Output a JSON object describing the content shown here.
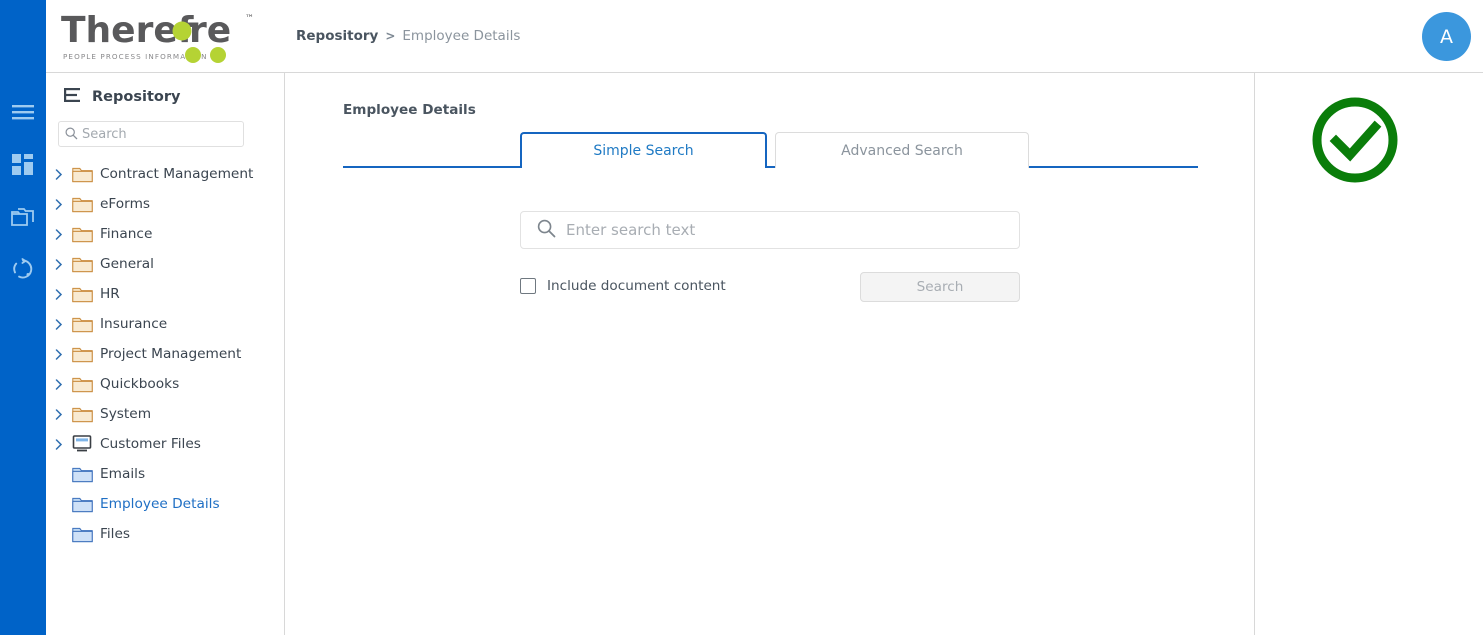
{
  "brand": {
    "name": "Therefore",
    "tagline": "PEOPLE PROCESS INFORMATION",
    "logo_text_color": "#59595b",
    "logo_accent_color": "#b5d334"
  },
  "rail": {
    "items": [
      {
        "name": "menu-icon",
        "label": "Menu"
      },
      {
        "name": "dashboard-icon",
        "label": "Dashboard"
      },
      {
        "name": "folders-icon",
        "label": "Folders"
      },
      {
        "name": "sync-icon",
        "label": "Sync"
      }
    ],
    "background": "#0063c8"
  },
  "header": {
    "breadcrumb": {
      "root": "Repository",
      "separator": ">",
      "leaf": "Employee Details"
    },
    "avatar": {
      "initial": "A",
      "color": "#3b97dd"
    }
  },
  "sidebar": {
    "title": "Repository",
    "search": {
      "value": "",
      "placeholder": "Search"
    },
    "tree": [
      {
        "label": "Contract Management",
        "icon": "folder-tan-icon",
        "expandable": true,
        "selected": false
      },
      {
        "label": "eForms",
        "icon": "folder-tan-icon",
        "expandable": true,
        "selected": false
      },
      {
        "label": "Finance",
        "icon": "folder-tan-icon",
        "expandable": true,
        "selected": false
      },
      {
        "label": "General",
        "icon": "folder-tan-icon",
        "expandable": true,
        "selected": false
      },
      {
        "label": "HR",
        "icon": "folder-tan-icon",
        "expandable": true,
        "selected": false
      },
      {
        "label": "Insurance",
        "icon": "folder-tan-icon",
        "expandable": true,
        "selected": false
      },
      {
        "label": "Project Management",
        "icon": "folder-tan-icon",
        "expandable": true,
        "selected": false
      },
      {
        "label": "Quickbooks",
        "icon": "folder-tan-icon",
        "expandable": true,
        "selected": false
      },
      {
        "label": "System",
        "icon": "folder-tan-icon",
        "expandable": true,
        "selected": false
      },
      {
        "label": "Customer Files",
        "icon": "monitor-icon",
        "expandable": true,
        "selected": false
      },
      {
        "label": "Emails",
        "icon": "folder-blue-icon",
        "expandable": false,
        "selected": false
      },
      {
        "label": "Employee Details",
        "icon": "folder-blue-icon",
        "expandable": false,
        "selected": true
      },
      {
        "label": "Files",
        "icon": "folder-blue-icon",
        "expandable": false,
        "selected": false
      }
    ]
  },
  "main": {
    "page_title": "Employee Details",
    "tabs": [
      {
        "label": "Simple Search",
        "active": true
      },
      {
        "label": "Advanced Search",
        "active": false
      }
    ],
    "search": {
      "value": "",
      "placeholder": "Enter search text"
    },
    "include_content": {
      "label": "Include document content",
      "checked": false
    },
    "search_button": {
      "label": "Search",
      "disabled": true
    },
    "accent_color": "#1565c0"
  },
  "right_panel": {
    "status_icon": {
      "name": "check-circle-icon",
      "color": "#0a7d0a"
    }
  }
}
